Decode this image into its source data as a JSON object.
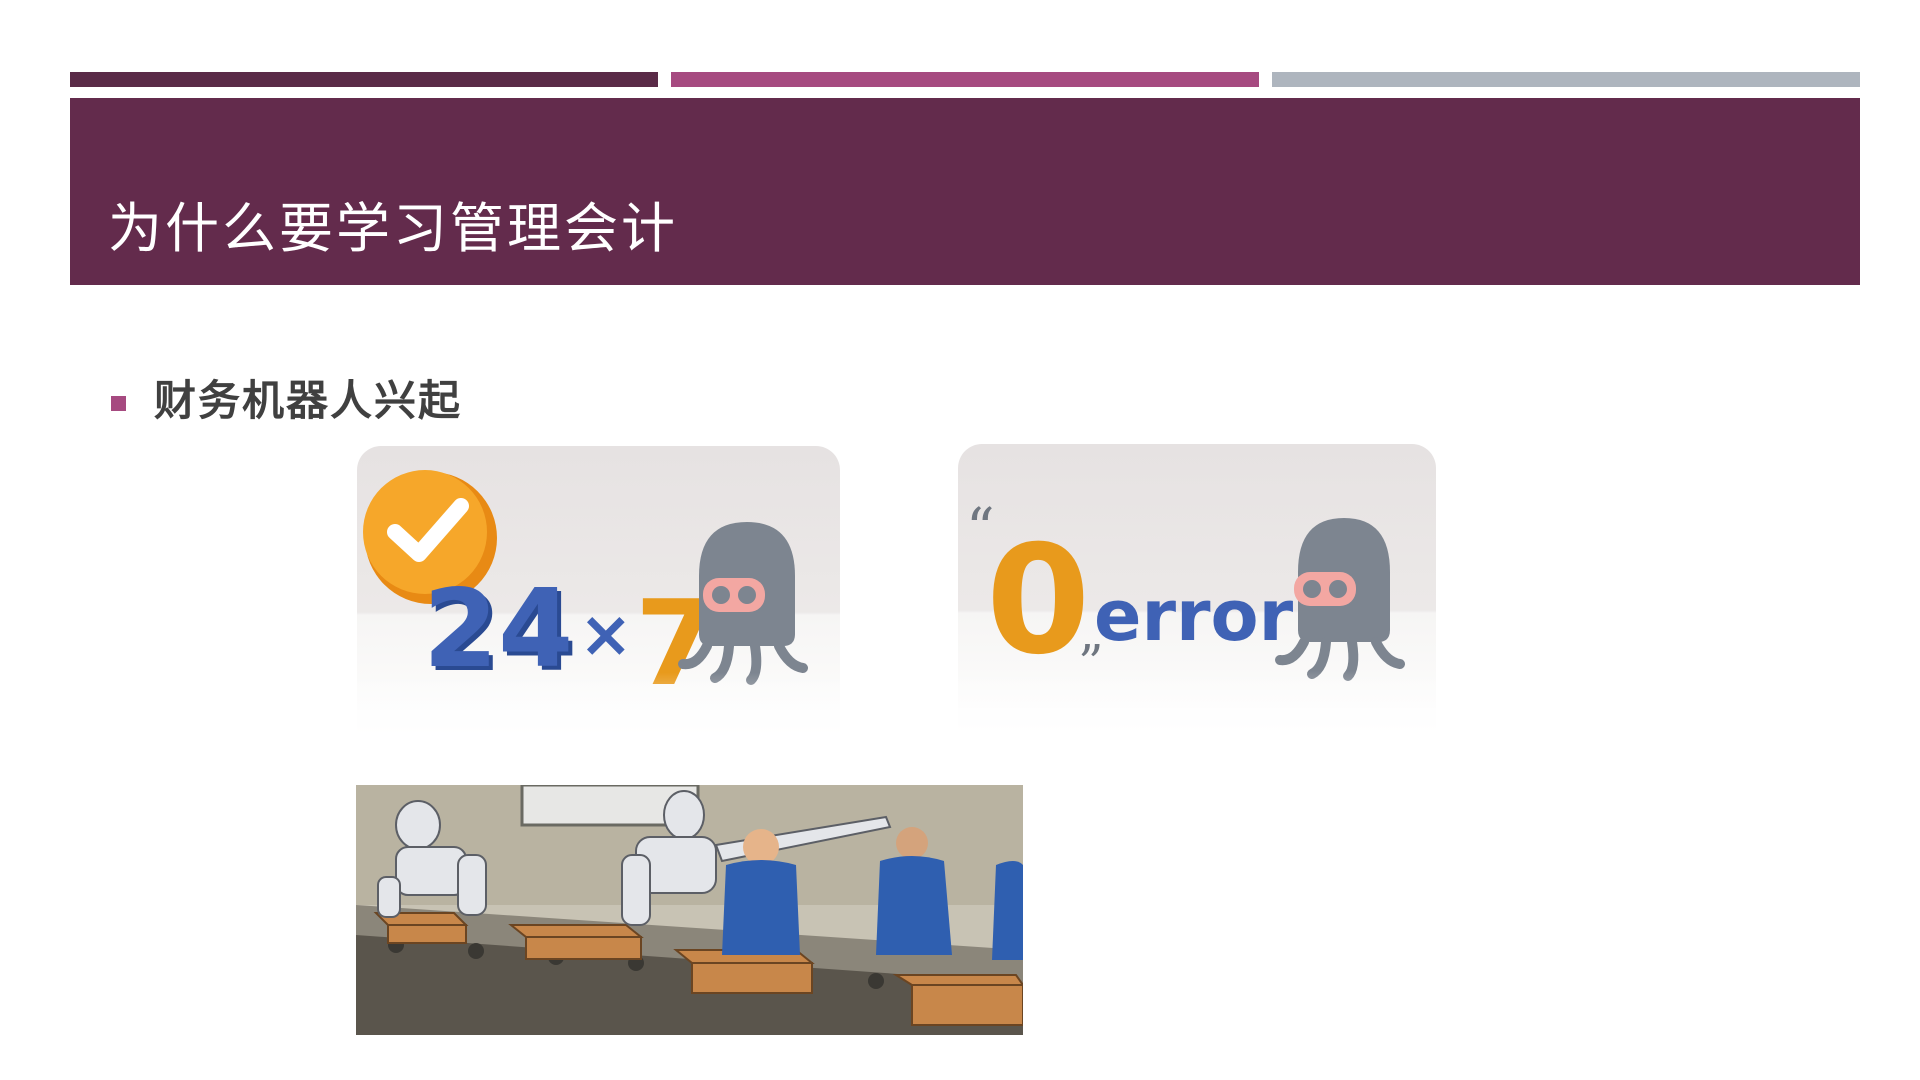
{
  "slide": {
    "title": "为什么要学习管理会计",
    "bullet": "财务机器人兴起"
  },
  "images": {
    "panel1": {
      "main_text": "24",
      "times": "×",
      "seven": "7",
      "icon": "check-icon"
    },
    "panel2": {
      "zero": "0",
      "word": "error",
      "quote_open": "“",
      "quote_close": "”"
    }
  },
  "colors": {
    "dark_plum": "#632b4c",
    "magenta": "#a64a80",
    "gray": "#aeb5be",
    "orange": "#f5a623",
    "blue": "#3a5aa8"
  }
}
